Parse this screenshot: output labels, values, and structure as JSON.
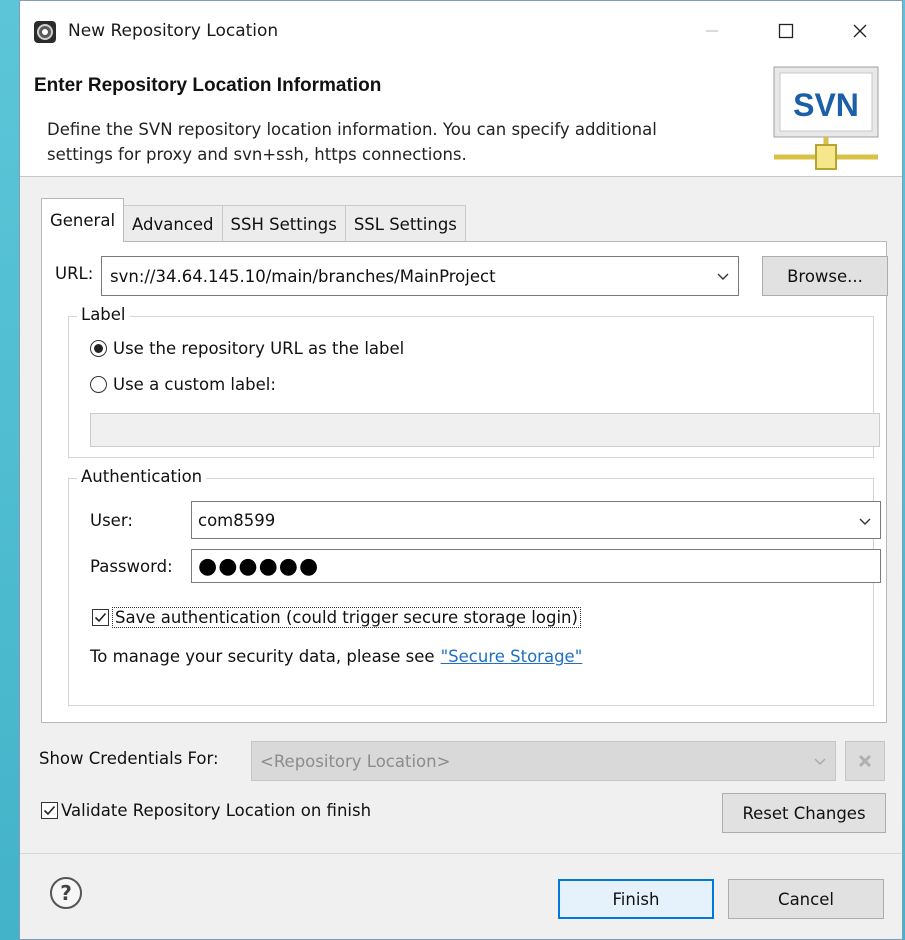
{
  "window": {
    "title": "New Repository Location",
    "controls": [
      "minimize",
      "maximize",
      "close"
    ]
  },
  "header": {
    "title": "Enter Repository Location Information",
    "description": "Define the SVN repository location information. You can specify additional settings for proxy and svn+ssh, https connections.",
    "badge_text": "SVN"
  },
  "tabs": [
    {
      "label": "General",
      "active": true
    },
    {
      "label": "Advanced",
      "active": false
    },
    {
      "label": "SSH Settings",
      "active": false
    },
    {
      "label": "SSL Settings",
      "active": false
    }
  ],
  "general": {
    "url_label": "URL:",
    "url_value": "svn://34.64.145.10/main/branches/MainProject",
    "browse_label": "Browse...",
    "label_group": {
      "legend": "Label",
      "option_repo": "Use the repository URL as the label",
      "option_custom": "Use a custom label:",
      "selected": "repo",
      "custom_value": ""
    },
    "auth_group": {
      "legend": "Authentication",
      "user_label": "User:",
      "user_value": "com8599",
      "password_label": "Password:",
      "password_value": "●●●●●●",
      "save_auth_label": "Save authentication (could trigger secure storage login)",
      "save_auth_checked": true,
      "manage_text": "To manage your security data, please see ",
      "manage_link": "\"Secure Storage\""
    }
  },
  "credentials": {
    "label": "Show Credentials For:",
    "value": "<Repository Location>"
  },
  "validate": {
    "label": "Validate Repository Location on finish",
    "checked": true
  },
  "buttons": {
    "reset": "Reset Changes",
    "finish": "Finish",
    "cancel": "Cancel",
    "help": "?"
  },
  "colors": {
    "accent": "#0078d7",
    "link": "#1f6fc4",
    "svn_badge": "#1b5fa8",
    "svn_connector": "#d8c246"
  },
  "icons": {
    "app": "eclipse-gear-icon",
    "clear_credentials": "clear-x-icon"
  }
}
